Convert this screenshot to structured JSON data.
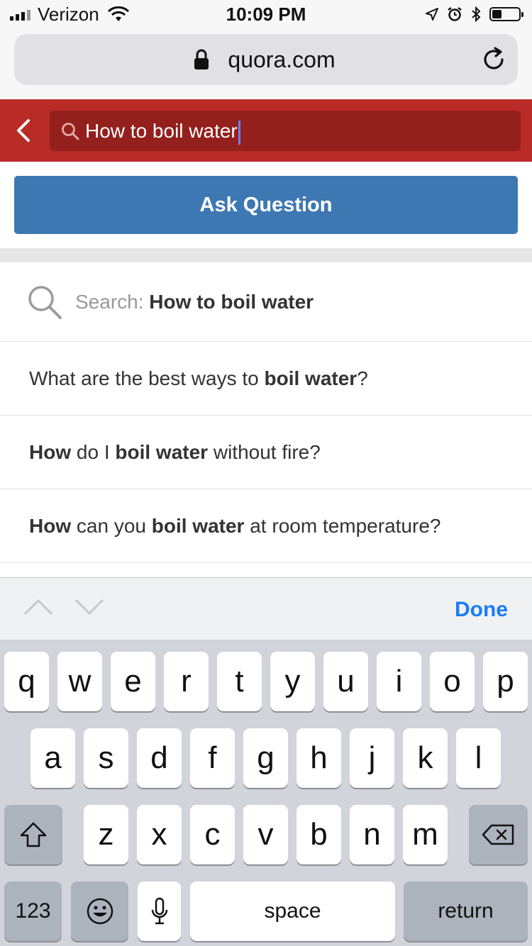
{
  "status_bar": {
    "carrier": "Verizon",
    "time": "10:09 PM"
  },
  "browser": {
    "url": "quora.com"
  },
  "search": {
    "query": "How to boil water"
  },
  "ask_button": {
    "label": "Ask Question"
  },
  "suggestions": {
    "search_row": {
      "prefix": "Search:",
      "query": "How to boil water"
    },
    "rows": [
      {
        "segments": [
          {
            "t": "What are the best ways to ",
            "b": false
          },
          {
            "t": "boil water",
            "b": true
          },
          {
            "t": "?",
            "b": false
          }
        ]
      },
      {
        "segments": [
          {
            "t": "How",
            "b": true
          },
          {
            "t": " do I ",
            "b": false
          },
          {
            "t": "boil water",
            "b": true
          },
          {
            "t": " without fire?",
            "b": false
          }
        ]
      },
      {
        "segments": [
          {
            "t": "How",
            "b": true
          },
          {
            "t": " can you ",
            "b": false
          },
          {
            "t": "boil water",
            "b": true
          },
          {
            "t": " at room temperature?",
            "b": false
          }
        ]
      }
    ]
  },
  "accessory_bar": {
    "done_label": "Done"
  },
  "keyboard": {
    "row1": [
      "q",
      "w",
      "e",
      "r",
      "t",
      "y",
      "u",
      "i",
      "o",
      "p"
    ],
    "row2": [
      "a",
      "s",
      "d",
      "f",
      "g",
      "h",
      "j",
      "k",
      "l"
    ],
    "row3": [
      "z",
      "x",
      "c",
      "v",
      "b",
      "n",
      "m"
    ],
    "numbers_label": "123",
    "space_label": "space",
    "return_label": "return"
  },
  "colors": {
    "header_red": "#b92b27",
    "search_field": "#93201d",
    "ask_button": "#3e78b3",
    "done_blue": "#1a7cf5"
  },
  "icons": [
    "signal-bars-icon",
    "wifi-icon",
    "location-icon",
    "alarm-icon",
    "bluetooth-icon",
    "battery-icon",
    "lock-icon",
    "reload-icon",
    "back-icon",
    "search-icon",
    "chevron-up-icon",
    "chevron-down-icon",
    "shift-icon",
    "emoji-icon",
    "microphone-icon",
    "delete-icon"
  ],
  "battery_level": 0.35
}
